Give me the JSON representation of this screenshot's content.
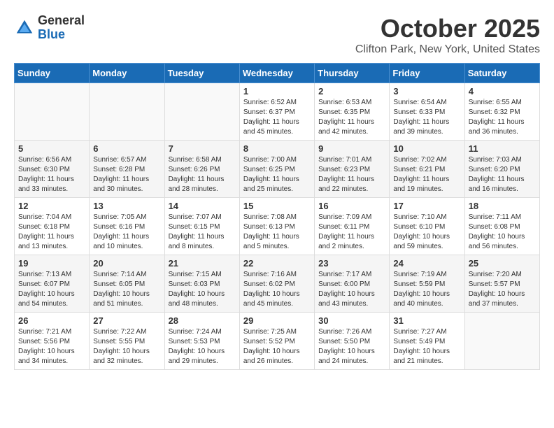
{
  "header": {
    "logo_general": "General",
    "logo_blue": "Blue",
    "month_title": "October 2025",
    "location": "Clifton Park, New York, United States"
  },
  "calendar": {
    "headers": [
      "Sunday",
      "Monday",
      "Tuesday",
      "Wednesday",
      "Thursday",
      "Friday",
      "Saturday"
    ],
    "weeks": [
      [
        {
          "day": "",
          "info": ""
        },
        {
          "day": "",
          "info": ""
        },
        {
          "day": "",
          "info": ""
        },
        {
          "day": "1",
          "info": "Sunrise: 6:52 AM\nSunset: 6:37 PM\nDaylight: 11 hours\nand 45 minutes."
        },
        {
          "day": "2",
          "info": "Sunrise: 6:53 AM\nSunset: 6:35 PM\nDaylight: 11 hours\nand 42 minutes."
        },
        {
          "day": "3",
          "info": "Sunrise: 6:54 AM\nSunset: 6:33 PM\nDaylight: 11 hours\nand 39 minutes."
        },
        {
          "day": "4",
          "info": "Sunrise: 6:55 AM\nSunset: 6:32 PM\nDaylight: 11 hours\nand 36 minutes."
        }
      ],
      [
        {
          "day": "5",
          "info": "Sunrise: 6:56 AM\nSunset: 6:30 PM\nDaylight: 11 hours\nand 33 minutes."
        },
        {
          "day": "6",
          "info": "Sunrise: 6:57 AM\nSunset: 6:28 PM\nDaylight: 11 hours\nand 30 minutes."
        },
        {
          "day": "7",
          "info": "Sunrise: 6:58 AM\nSunset: 6:26 PM\nDaylight: 11 hours\nand 28 minutes."
        },
        {
          "day": "8",
          "info": "Sunrise: 7:00 AM\nSunset: 6:25 PM\nDaylight: 11 hours\nand 25 minutes."
        },
        {
          "day": "9",
          "info": "Sunrise: 7:01 AM\nSunset: 6:23 PM\nDaylight: 11 hours\nand 22 minutes."
        },
        {
          "day": "10",
          "info": "Sunrise: 7:02 AM\nSunset: 6:21 PM\nDaylight: 11 hours\nand 19 minutes."
        },
        {
          "day": "11",
          "info": "Sunrise: 7:03 AM\nSunset: 6:20 PM\nDaylight: 11 hours\nand 16 minutes."
        }
      ],
      [
        {
          "day": "12",
          "info": "Sunrise: 7:04 AM\nSunset: 6:18 PM\nDaylight: 11 hours\nand 13 minutes."
        },
        {
          "day": "13",
          "info": "Sunrise: 7:05 AM\nSunset: 6:16 PM\nDaylight: 11 hours\nand 10 minutes."
        },
        {
          "day": "14",
          "info": "Sunrise: 7:07 AM\nSunset: 6:15 PM\nDaylight: 11 hours\nand 8 minutes."
        },
        {
          "day": "15",
          "info": "Sunrise: 7:08 AM\nSunset: 6:13 PM\nDaylight: 11 hours\nand 5 minutes."
        },
        {
          "day": "16",
          "info": "Sunrise: 7:09 AM\nSunset: 6:11 PM\nDaylight: 11 hours\nand 2 minutes."
        },
        {
          "day": "17",
          "info": "Sunrise: 7:10 AM\nSunset: 6:10 PM\nDaylight: 10 hours\nand 59 minutes."
        },
        {
          "day": "18",
          "info": "Sunrise: 7:11 AM\nSunset: 6:08 PM\nDaylight: 10 hours\nand 56 minutes."
        }
      ],
      [
        {
          "day": "19",
          "info": "Sunrise: 7:13 AM\nSunset: 6:07 PM\nDaylight: 10 hours\nand 54 minutes."
        },
        {
          "day": "20",
          "info": "Sunrise: 7:14 AM\nSunset: 6:05 PM\nDaylight: 10 hours\nand 51 minutes."
        },
        {
          "day": "21",
          "info": "Sunrise: 7:15 AM\nSunset: 6:03 PM\nDaylight: 10 hours\nand 48 minutes."
        },
        {
          "day": "22",
          "info": "Sunrise: 7:16 AM\nSunset: 6:02 PM\nDaylight: 10 hours\nand 45 minutes."
        },
        {
          "day": "23",
          "info": "Sunrise: 7:17 AM\nSunset: 6:00 PM\nDaylight: 10 hours\nand 43 minutes."
        },
        {
          "day": "24",
          "info": "Sunrise: 7:19 AM\nSunset: 5:59 PM\nDaylight: 10 hours\nand 40 minutes."
        },
        {
          "day": "25",
          "info": "Sunrise: 7:20 AM\nSunset: 5:57 PM\nDaylight: 10 hours\nand 37 minutes."
        }
      ],
      [
        {
          "day": "26",
          "info": "Sunrise: 7:21 AM\nSunset: 5:56 PM\nDaylight: 10 hours\nand 34 minutes."
        },
        {
          "day": "27",
          "info": "Sunrise: 7:22 AM\nSunset: 5:55 PM\nDaylight: 10 hours\nand 32 minutes."
        },
        {
          "day": "28",
          "info": "Sunrise: 7:24 AM\nSunset: 5:53 PM\nDaylight: 10 hours\nand 29 minutes."
        },
        {
          "day": "29",
          "info": "Sunrise: 7:25 AM\nSunset: 5:52 PM\nDaylight: 10 hours\nand 26 minutes."
        },
        {
          "day": "30",
          "info": "Sunrise: 7:26 AM\nSunset: 5:50 PM\nDaylight: 10 hours\nand 24 minutes."
        },
        {
          "day": "31",
          "info": "Sunrise: 7:27 AM\nSunset: 5:49 PM\nDaylight: 10 hours\nand 21 minutes."
        },
        {
          "day": "",
          "info": ""
        }
      ]
    ]
  }
}
